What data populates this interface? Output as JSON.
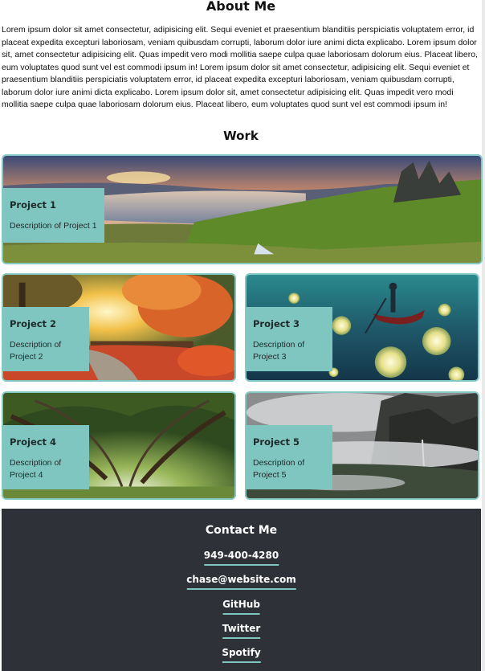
{
  "about": {
    "title": "About Me",
    "body": "Lorem ipsum dolor sit amet consectetur, adipisicing elit. Sequi eveniet et praesentium blanditiis perspiciatis voluptatem error, id placeat expedita excepturi laboriosam, veniam quibusdam corrupti, laborum dolor iure animi dicta explicabo. Lorem ipsum dolor sit, amet consectetur adipisicing elit. Quas impedit vero modi mollitia saepe culpa quae laboriosam dolorum eius. Placeat libero, eum voluptates quod sunt vel est commodi ipsum in! Lorem ipsum dolor sit amet consectetur, adipisicing elit. Sequi eveniet et praesentium blanditiis perspiciatis voluptatem error, id placeat expedita excepturi laboriosam, veniam quibusdam corrupti, laborum dolor iure animi dicta explicabo. Lorem ipsum dolor sit, amet consectetur adipisicing elit. Quas impedit vero modi mollitia saepe culpa quae laboriosam dolorum eius. Placeat libero, eum voluptates quod sunt vel est commodi ipsum in!"
  },
  "work": {
    "title": "Work",
    "projects": [
      {
        "title": "Project 1",
        "description": "Description of Project 1",
        "image": "mountain-lake-sunset"
      },
      {
        "title": "Project 2",
        "description": "Description of Project 2",
        "image": "autumn-park-bridge"
      },
      {
        "title": "Project 3",
        "description": "Description of Project 3",
        "image": "boat-glowing-orbs"
      },
      {
        "title": "Project 4",
        "description": "Description of Project 4",
        "image": "oak-tree-tunnel"
      },
      {
        "title": "Project 5",
        "description": "Description of Project 5",
        "image": "misty-canyon"
      }
    ]
  },
  "contact": {
    "title": "Contact Me",
    "phone": "949-400-4280",
    "email": "chase@website.com",
    "github": "GitHub",
    "twitter": "Twitter",
    "spotify": "Spotify"
  },
  "colors": {
    "accent": "#7fc6c0",
    "footer_bg": "#2e3138"
  }
}
